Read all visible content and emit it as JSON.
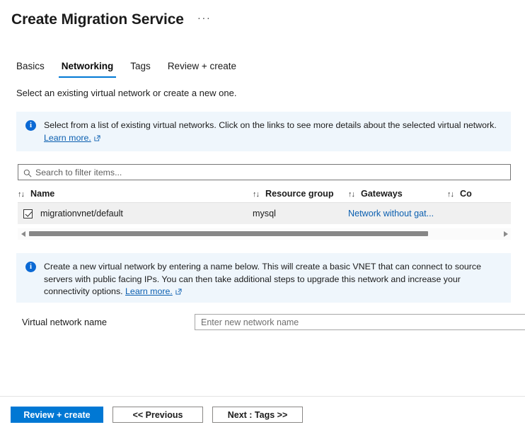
{
  "header": {
    "title": "Create Migration Service",
    "more_menu": "···"
  },
  "tabs": [
    {
      "label": "Basics",
      "active": false
    },
    {
      "label": "Networking",
      "active": true
    },
    {
      "label": "Tags",
      "active": false
    },
    {
      "label": "Review + create",
      "active": false
    }
  ],
  "subtitle": "Select an existing virtual network or create a new one.",
  "banner_existing": {
    "icon": "info-icon",
    "text": "Select from a list of existing virtual networks. Click on the links to see more details about the selected virtual network.",
    "link_label": "Learn more."
  },
  "search": {
    "placeholder": "Search to filter items...",
    "icon": "search-icon"
  },
  "table": {
    "sort_icon": "↑↓",
    "columns": [
      {
        "label": "Name"
      },
      {
        "label": "Resource group"
      },
      {
        "label": "Gateways"
      },
      {
        "label": "Co"
      }
    ],
    "rows": [
      {
        "selected": true,
        "name": "migrationvnet/default",
        "resource_group": "mysql",
        "gateways": "Network without gat..."
      }
    ]
  },
  "scrollbar": {
    "left_arrow": "scroll-left-arrow",
    "right_arrow": "scroll-right-arrow"
  },
  "banner_create": {
    "icon": "info-icon",
    "text": "Create a new virtual network by entering a name below. This will create a basic VNET that can connect to source servers with public facing IPs. You can then take additional steps to upgrade this network and increase your connectivity options.",
    "link_label": "Learn more."
  },
  "vnet_field": {
    "label": "Virtual network name",
    "value": "",
    "placeholder": "Enter new network name"
  },
  "footer": {
    "review_create": "Review + create",
    "previous": "<< Previous",
    "next": "Next : Tags >>"
  },
  "colors": {
    "accent": "#0078d4",
    "link": "#0b5fb0",
    "banner_bg": "#eff6fc",
    "row_bg": "#f0f0f0"
  }
}
